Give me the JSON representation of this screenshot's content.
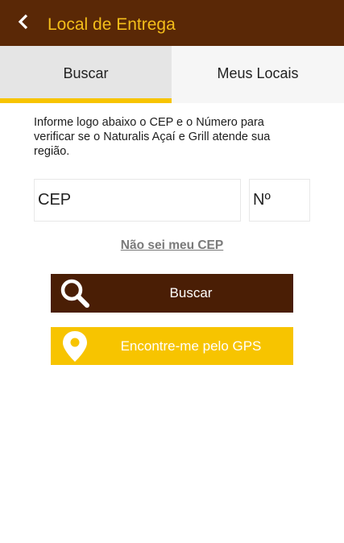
{
  "header": {
    "title": "Local de Entrega",
    "back_icon": "chevron-left-icon",
    "background_color": "#5a2806",
    "title_color": "#f4be1a"
  },
  "tabs": [
    {
      "label": "Buscar",
      "active": true
    },
    {
      "label": "Meus Locais",
      "active": false
    }
  ],
  "main": {
    "instructions": "Informe logo abaixo o CEP e o Número para verificar se o Naturalis Açaí e Grill atende sua região.",
    "cep_field": {
      "placeholder": "CEP",
      "value": ""
    },
    "number_field": {
      "placeholder": "Nº",
      "value": ""
    },
    "unknown_cep_link": "Não sei meu CEP",
    "search_button": {
      "label": "Buscar",
      "icon": "search-icon",
      "color": "#4a1e05"
    },
    "gps_button": {
      "label": "Encontre-me pelo GPS",
      "icon": "map-pin-icon",
      "color": "#f7c400"
    }
  },
  "accent_color": "#f7c400"
}
